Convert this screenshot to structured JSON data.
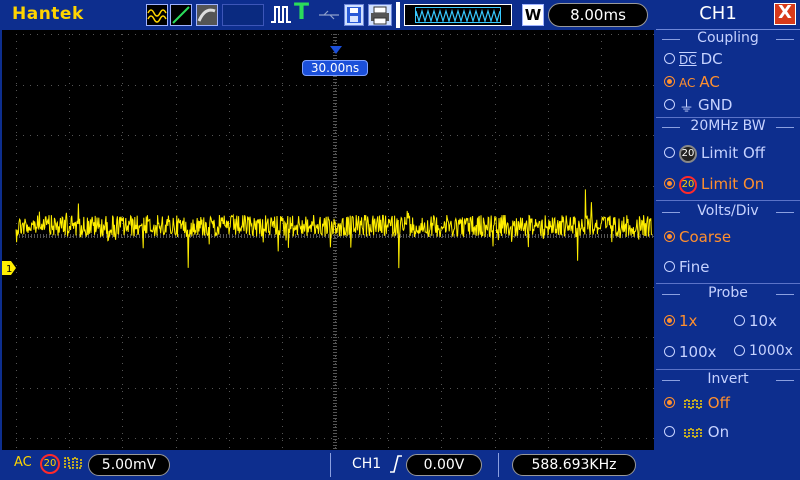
{
  "topbar": {
    "brand": "Hantek",
    "timebase": "8.00ms",
    "memory_label": "W",
    "icons": [
      "acquire-wave-icon",
      "acquire-line-icon",
      "persist-icon",
      "pulse-icon",
      "trigger-icon",
      "usb-icon",
      "save-icon",
      "print-icon",
      "memory-depth-icon"
    ]
  },
  "scope": {
    "trigger_position": "30.00ns",
    "channel_marker": "1",
    "trace_color": "#ffee00",
    "grid_color": "#555555",
    "divisions": {
      "horizontal": 12,
      "vertical": 8
    }
  },
  "bottombar": {
    "coupling": "AC",
    "bw_limit": "20",
    "volts_div": "5.00mV",
    "trigger_source": "CH1",
    "trigger_slope": "rising",
    "trigger_level": "0.00V",
    "frequency": "588.693KHz"
  },
  "menu": {
    "title": "CH1",
    "close": "X",
    "groups": {
      "coupling": {
        "label": "Coupling",
        "options": [
          {
            "label": "DC",
            "glyph": "DC",
            "selected": false
          },
          {
            "label": "AC",
            "glyph": "AC",
            "selected": true
          },
          {
            "label": "GND",
            "glyph": "⏚",
            "selected": false
          }
        ]
      },
      "bw": {
        "label": "20MHz BW",
        "options": [
          {
            "label": "Limit Off",
            "selected": false
          },
          {
            "label": "Limit On",
            "selected": true
          }
        ]
      },
      "volts": {
        "label": "Volts/Div",
        "options": [
          {
            "label": "Coarse",
            "selected": true
          },
          {
            "label": "Fine",
            "selected": false
          }
        ]
      },
      "probe": {
        "label": "Probe",
        "options": [
          {
            "label": "1x",
            "selected": true
          },
          {
            "label": "10x",
            "selected": false
          },
          {
            "label": "100x",
            "selected": false
          },
          {
            "label": "1000x",
            "selected": false
          }
        ]
      },
      "invert": {
        "label": "Invert",
        "options": [
          {
            "label": "Off",
            "selected": true
          },
          {
            "label": "On",
            "selected": false
          }
        ]
      }
    }
  }
}
